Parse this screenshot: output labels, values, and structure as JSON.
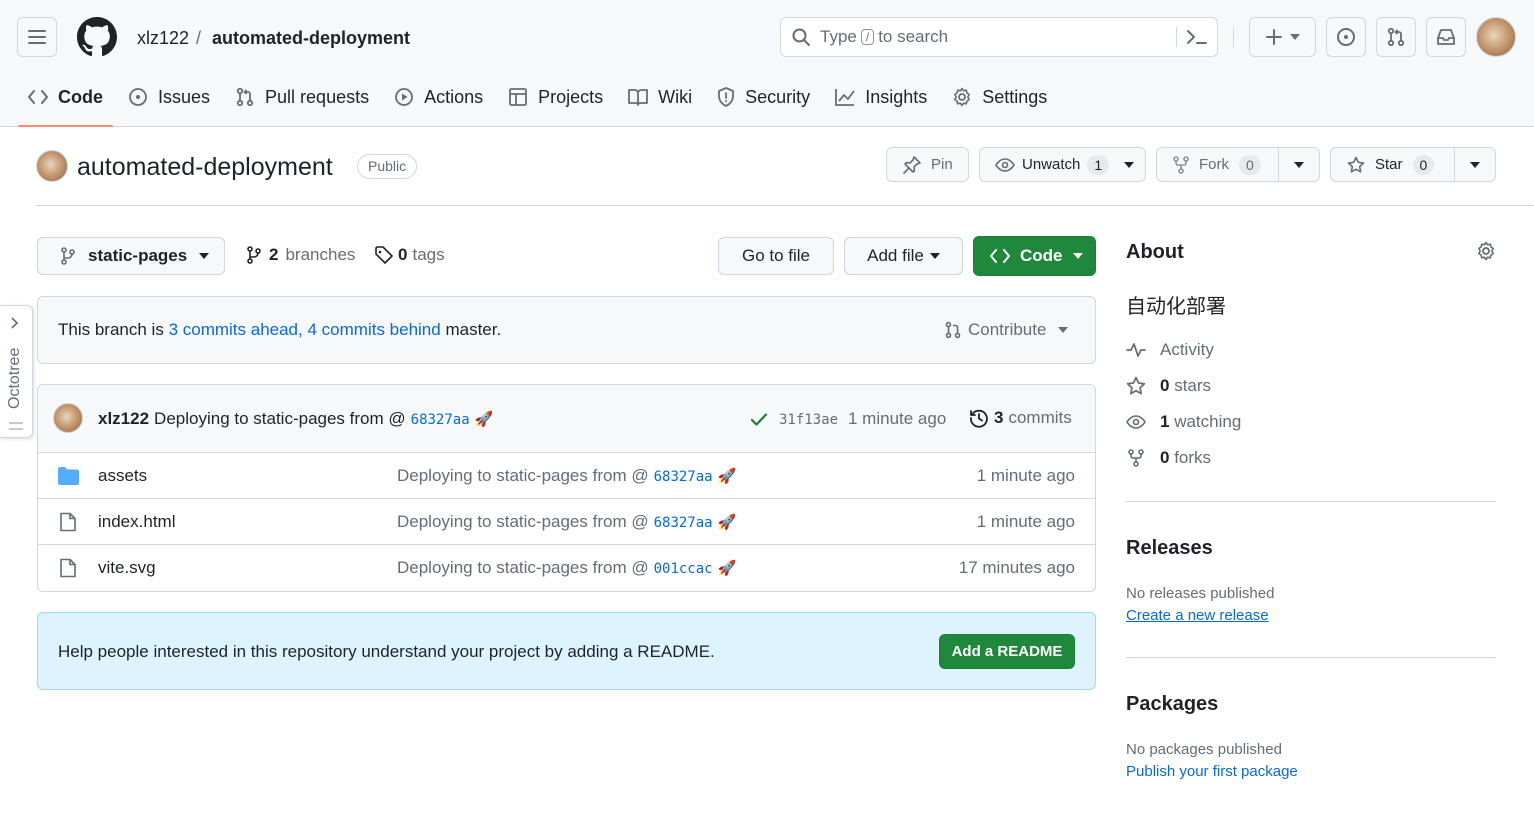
{
  "header": {
    "owner": "xlz122",
    "separator": "/",
    "repo": "automated-deployment",
    "search": {
      "prefix": "Type",
      "key": "/",
      "suffix": "to search"
    }
  },
  "tabs": [
    {
      "label": "Code",
      "icon": "code-icon"
    },
    {
      "label": "Issues",
      "icon": "issue-icon"
    },
    {
      "label": "Pull requests",
      "icon": "pull-request-icon"
    },
    {
      "label": "Actions",
      "icon": "play-icon"
    },
    {
      "label": "Projects",
      "icon": "table-icon"
    },
    {
      "label": "Wiki",
      "icon": "book-icon"
    },
    {
      "label": "Security",
      "icon": "shield-icon"
    },
    {
      "label": "Insights",
      "icon": "graph-icon"
    },
    {
      "label": "Settings",
      "icon": "gear-icon"
    }
  ],
  "repo_header": {
    "name": "automated-deployment",
    "visibility": "Public",
    "pin_label": "Pin",
    "unwatch_label": "Unwatch",
    "watch_count": "1",
    "fork_label": "Fork",
    "fork_count": "0",
    "star_label": "Star",
    "star_count": "0"
  },
  "branch_bar": {
    "branch": "static-pages",
    "branches_count": "2",
    "branches_label": "branches",
    "tags_count": "0",
    "tags_label": "tags",
    "goto_file": "Go to file",
    "add_file": "Add file",
    "code_button": "Code"
  },
  "branch_status": {
    "prefix": "This branch is",
    "ahead": "3 commits ahead,",
    "behind": "4 commits behind",
    "suffix": "master.",
    "contribute": "Contribute"
  },
  "latest_commit": {
    "author": "xlz122",
    "message": "Deploying to static-pages from @",
    "sha_link": "68327aa",
    "emoji": "🚀",
    "sha": "31f13ae",
    "time": "1 minute ago",
    "commits_count": "3",
    "commits_label": "commits"
  },
  "files": [
    {
      "name": "assets",
      "type": "folder",
      "message": "Deploying to static-pages from @",
      "sha": "68327aa",
      "emoji": "🚀",
      "time": "1 minute ago"
    },
    {
      "name": "index.html",
      "type": "file",
      "message": "Deploying to static-pages from @",
      "sha": "68327aa",
      "emoji": "🚀",
      "time": "1 minute ago"
    },
    {
      "name": "vite.svg",
      "type": "file",
      "message": "Deploying to static-pages from @",
      "sha": "001ccac",
      "emoji": "🚀",
      "time": "17 minutes ago"
    }
  ],
  "readme_banner": {
    "text": "Help people interested in this repository understand your project by adding a README.",
    "button": "Add a README"
  },
  "about": {
    "title": "About",
    "description": "自动化部署",
    "activity": "Activity",
    "stars_count": "0",
    "stars_label": "stars",
    "watching_count": "1",
    "watching_label": "watching",
    "forks_count": "0",
    "forks_label": "forks"
  },
  "releases": {
    "title": "Releases",
    "empty": "No releases published",
    "link": "Create a new release"
  },
  "packages": {
    "title": "Packages",
    "empty": "No packages published",
    "link": "Publish your first package"
  },
  "octotree": {
    "label": "Octotree"
  },
  "colors": {
    "accent_green": "#1f883d",
    "link_blue": "#0969da",
    "tab_underline": "#fd8c73",
    "banner_bg": "#ddf4ff"
  }
}
